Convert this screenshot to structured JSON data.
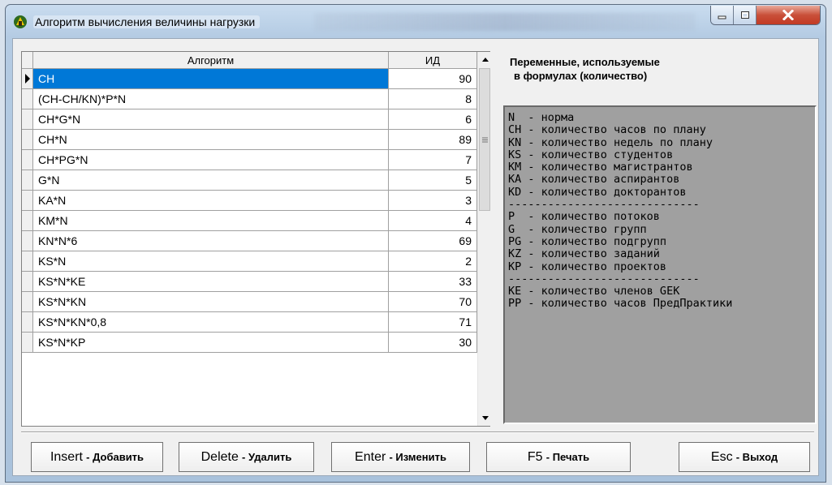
{
  "window": {
    "title": "Алгоритм вычисления величины нагрузки"
  },
  "grid": {
    "columns": {
      "algorithm": "Алгоритм",
      "id": "ИД"
    },
    "rows": [
      {
        "algorithm": "CH",
        "id": "90"
      },
      {
        "algorithm": "(CH-CH/KN)*P*N",
        "id": "8"
      },
      {
        "algorithm": "CH*G*N",
        "id": "6"
      },
      {
        "algorithm": "CH*N",
        "id": "89"
      },
      {
        "algorithm": "CH*PG*N",
        "id": "7"
      },
      {
        "algorithm": "G*N",
        "id": "5"
      },
      {
        "algorithm": "KA*N",
        "id": "3"
      },
      {
        "algorithm": "KM*N",
        "id": "4"
      },
      {
        "algorithm": "KN*N*6",
        "id": "69"
      },
      {
        "algorithm": "KS*N",
        "id": "2"
      },
      {
        "algorithm": "KS*N*KE",
        "id": "33"
      },
      {
        "algorithm": "KS*N*KN",
        "id": "70"
      },
      {
        "algorithm": "KS*N*KN*0,8",
        "id": "71"
      },
      {
        "algorithm": "KS*N*KP",
        "id": "30"
      }
    ],
    "selected_row": 0
  },
  "variables": {
    "title_line1": "Переменные, используемые",
    "title_line2": "в формулах (количество)",
    "lines": [
      "N  - норма",
      "CH - количество часов по плану",
      "KN - количество недель по плану",
      "KS - количество студентов",
      "KM - количество магистрантов",
      "KA - количество аспирантов",
      "KD - количество докторантов",
      "-----------------------------",
      "P  - количество потоков",
      "G  - количество групп",
      "PG - количество подгрупп",
      "KZ - количество заданий",
      "KP - количество проектов",
      "-----------------------------",
      "KE - количество членов GEK",
      "PP - количество часов ПредПрактики"
    ]
  },
  "buttons": {
    "insert": {
      "key": "Insert",
      "label": "- Добавить"
    },
    "delete": {
      "key": "Delete",
      "label": "- Удалить"
    },
    "enter": {
      "key": "Enter",
      "label": "- Изменить"
    },
    "print": {
      "key": "F5",
      "label": "- Печать"
    },
    "exit": {
      "key": "Esc",
      "label": "- Выход"
    }
  }
}
